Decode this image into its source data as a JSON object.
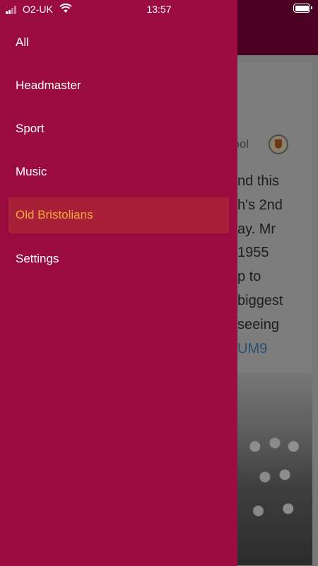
{
  "status_bar": {
    "carrier": "O2-UK",
    "time": "13:57"
  },
  "drawer": {
    "items": [
      {
        "label": "All"
      },
      {
        "label": "Headmaster"
      },
      {
        "label": "Sport"
      },
      {
        "label": "Music"
      },
      {
        "label": "Old Bristolians",
        "active": true
      },
      {
        "label": "Settings"
      }
    ],
    "background_color": "#9b0c3e",
    "active_text_color": "#f6a93a"
  },
  "background_feed": {
    "source_fragment": "hool",
    "text_lines": [
      "nd this",
      "h's 2nd",
      "ay. Mr",
      "1955",
      "p to",
      "biggest",
      "seeing"
    ],
    "link_fragment": "UM9"
  }
}
